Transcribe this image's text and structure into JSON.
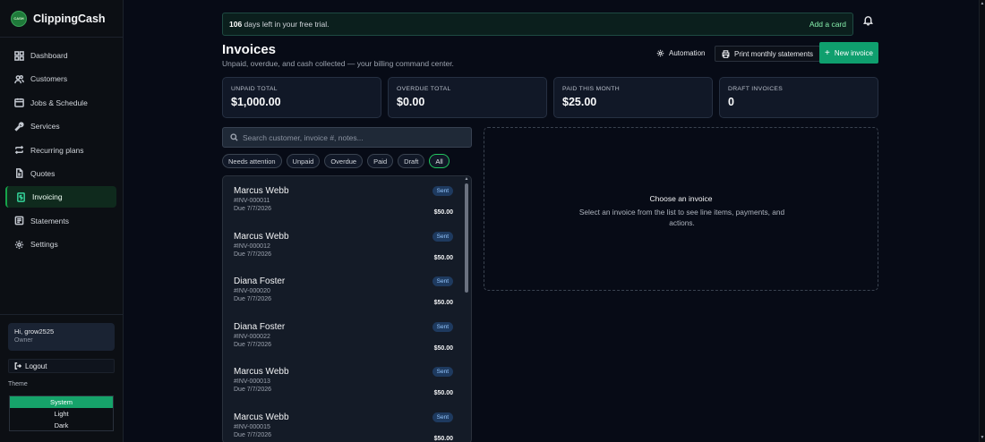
{
  "app": {
    "name": "ClippingCash",
    "logo_text": "CASH"
  },
  "sidebar": {
    "items": [
      {
        "label": "Dashboard",
        "icon": "grid-icon"
      },
      {
        "label": "Customers",
        "icon": "users-icon"
      },
      {
        "label": "Jobs & Schedule",
        "icon": "calendar-icon"
      },
      {
        "label": "Services",
        "icon": "wrench-icon"
      },
      {
        "label": "Recurring plans",
        "icon": "repeat-icon"
      },
      {
        "label": "Quotes",
        "icon": "document-icon"
      },
      {
        "label": "Invoicing",
        "icon": "invoice-icon",
        "active": true
      },
      {
        "label": "Statements",
        "icon": "statement-icon"
      },
      {
        "label": "Settings",
        "icon": "gear-icon"
      }
    ],
    "user": {
      "greeting": "Hi, grow2525",
      "role": "Owner"
    },
    "logout_label": "Logout",
    "theme": {
      "label": "Theme",
      "options": [
        "System",
        "Light",
        "Dark"
      ],
      "selected": "System"
    }
  },
  "trial_banner": {
    "days": "106",
    "text": " days left in your free trial.",
    "action": "Add a card"
  },
  "header": {
    "title": "Invoices",
    "subtitle": "Unpaid, overdue, and cash collected — your billing command center.",
    "automation_label": "Automation",
    "print_label": "Print monthly statements",
    "new_label": "New invoice"
  },
  "stats": [
    {
      "label": "UNPAID TOTAL",
      "value": "$1,000.00"
    },
    {
      "label": "OVERDUE TOTAL",
      "value": "$0.00"
    },
    {
      "label": "PAID THIS MONTH",
      "value": "$25.00"
    },
    {
      "label": "DRAFT INVOICES",
      "value": "0"
    }
  ],
  "search": {
    "placeholder": "Search customer, invoice #, notes..."
  },
  "filters": [
    {
      "label": "Needs attention"
    },
    {
      "label": "Unpaid"
    },
    {
      "label": "Overdue"
    },
    {
      "label": "Paid"
    },
    {
      "label": "Draft"
    },
    {
      "label": "All",
      "active": true
    }
  ],
  "invoices": [
    {
      "customer": "Marcus Webb",
      "number": "#INV-000011",
      "due": "Due 7/7/2026",
      "status": "Sent",
      "amount": "$50.00"
    },
    {
      "customer": "Marcus Webb",
      "number": "#INV-000012",
      "due": "Due 7/7/2026",
      "status": "Sent",
      "amount": "$50.00"
    },
    {
      "customer": "Diana Foster",
      "number": "#INV-000020",
      "due": "Due 7/7/2026",
      "status": "Sent",
      "amount": "$50.00"
    },
    {
      "customer": "Diana Foster",
      "number": "#INV-000022",
      "due": "Due 7/7/2026",
      "status": "Sent",
      "amount": "$50.00"
    },
    {
      "customer": "Marcus Webb",
      "number": "#INV-000013",
      "due": "Due 7/7/2026",
      "status": "Sent",
      "amount": "$50.00"
    },
    {
      "customer": "Marcus Webb",
      "number": "#INV-000015",
      "due": "Due 7/7/2026",
      "status": "Sent",
      "amount": "$50.00"
    }
  ],
  "detail": {
    "title": "Choose an invoice",
    "text": "Select an invoice from the list to see line items, payments, and actions."
  },
  "colors": {
    "accent": "#0f9f6e",
    "background": "#070b16",
    "badge_bg": "#1e3a5f",
    "badge_text": "#93c5fd"
  }
}
